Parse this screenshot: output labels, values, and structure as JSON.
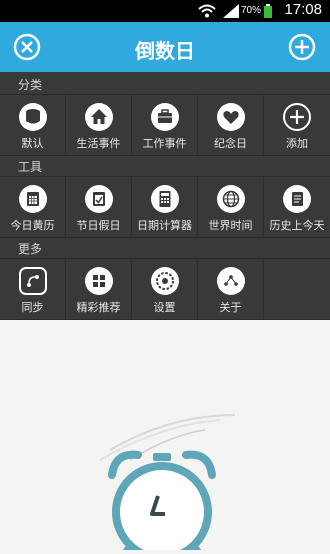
{
  "status": {
    "battery": "70%",
    "time": "17:08"
  },
  "header": {
    "title": "倒数日"
  },
  "sections": [
    {
      "title": "分类",
      "items": [
        {
          "label": "默认",
          "icon": "database-icon"
        },
        {
          "label": "生活事件",
          "icon": "home-icon"
        },
        {
          "label": "工作事件",
          "icon": "briefcase-icon"
        },
        {
          "label": "纪念日",
          "icon": "heart-icon"
        },
        {
          "label": "添加",
          "icon": "plus-icon"
        }
      ]
    },
    {
      "title": "工具",
      "items": [
        {
          "label": "今日黄历",
          "icon": "almanac-calendar-icon"
        },
        {
          "label": "节日假日",
          "icon": "holiday-calendar-icon"
        },
        {
          "label": "日期计算器",
          "icon": "calculator-icon"
        },
        {
          "label": "世界时间",
          "icon": "globe-icon"
        },
        {
          "label": "历史上今天",
          "icon": "notebook-icon"
        }
      ]
    },
    {
      "title": "更多",
      "items": [
        {
          "label": "同步",
          "icon": "sync-icon"
        },
        {
          "label": "精彩推荐",
          "icon": "grid-icon"
        },
        {
          "label": "设置",
          "icon": "settings-icon"
        },
        {
          "label": "关于",
          "icon": "about-icon"
        }
      ]
    }
  ],
  "colors": {
    "accent": "#2fa9de",
    "menu_bg": "#383939",
    "alarm": "#5ea6b8"
  }
}
